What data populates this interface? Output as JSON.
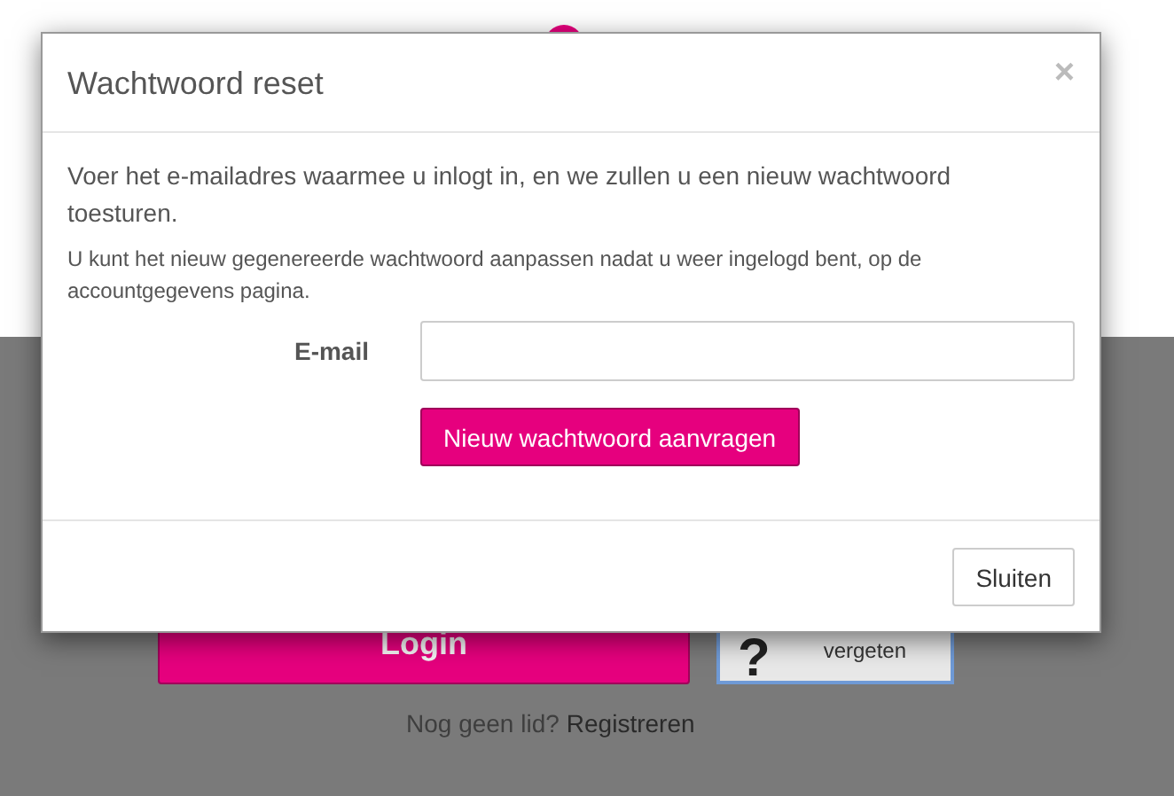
{
  "background": {
    "login_button": "Login",
    "forgot_button": {
      "icon": "?",
      "label": "vergeten"
    },
    "register_prompt": "Nog geen lid?",
    "register_link": "Registreren"
  },
  "modal": {
    "title": "Wachtwoord reset",
    "close": "×",
    "intro": "Voer het e-mailadres waarmee u inlogt in, en we zullen u een nieuw wachtwoord toesturen.",
    "note": "U kunt het nieuw gegenereerde wachtwoord aanpassen nadat u weer ingelogd bent, op de accountgegevens pagina.",
    "email_label": "E-mail",
    "submit": "Nieuw wachtwoord aanvragen",
    "footer_button": "Sluiten"
  }
}
